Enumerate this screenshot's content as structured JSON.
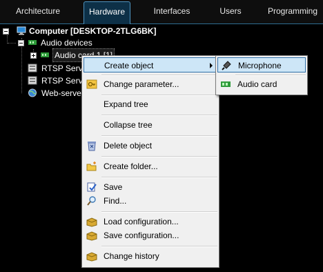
{
  "tabs": [
    {
      "label": "Architecture",
      "active": false
    },
    {
      "label": "Hardware",
      "active": true
    },
    {
      "label": "Interfaces",
      "active": false
    },
    {
      "label": "Users",
      "active": false
    },
    {
      "label": "Programming",
      "active": false
    }
  ],
  "tree": {
    "computer": "Computer [DESKTOP-2TLG6BK]",
    "audio_devices": "Audio devices",
    "audio_card": "Audio card 1 [1]",
    "rtsp_server_1": "RTSP Server",
    "rtsp_server_2": "RTSP Server",
    "web_server": "Web-server"
  },
  "context_menu": {
    "create_object": "Create object",
    "change_parameter": "Change parameter...",
    "expand_tree": "Expand tree",
    "collapse_tree": "Collapse tree",
    "delete_object": "Delete object",
    "create_folder": "Create folder...",
    "save": "Save",
    "find": "Find...",
    "load_configuration": "Load configuration...",
    "save_configuration": "Save configuration...",
    "change_history": "Change history"
  },
  "submenu": {
    "microphone": "Microphone",
    "audio_card": "Audio card"
  },
  "colors": {
    "tab_active_bg": "#0d3047",
    "tab_border": "#4f93bf",
    "selection_bg": "#cde6f7",
    "selection_border": "#2f6fa8",
    "menu_bg": "#f0f0f0"
  }
}
